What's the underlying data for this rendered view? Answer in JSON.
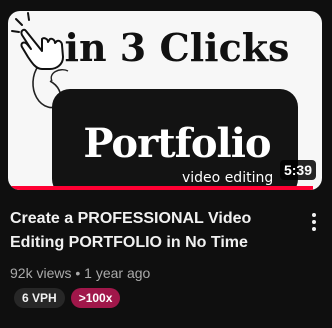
{
  "video": {
    "thumbnail": {
      "headline": "in 3 Clicks",
      "title": "Portfolio",
      "subtitle": "video editing",
      "hand_icon": "pointing-hand-icon"
    },
    "duration": "5:39",
    "watched_fraction": 0.97,
    "title": "Create a PROFESSIONAL Video Editing PORTFOLIO in No Time",
    "views": "92k views",
    "separator": "•",
    "age": "1 year ago",
    "menu_icon": "more-vert-icon",
    "badges": {
      "vph": "6 VPH",
      "ratio": ">100x"
    }
  },
  "colors": {
    "background": "#0f0f0f",
    "progress": "#ff0033",
    "ratio_badge": "#a0174a",
    "vph_badge": "#272727",
    "meta_text": "#aaaaaa"
  }
}
